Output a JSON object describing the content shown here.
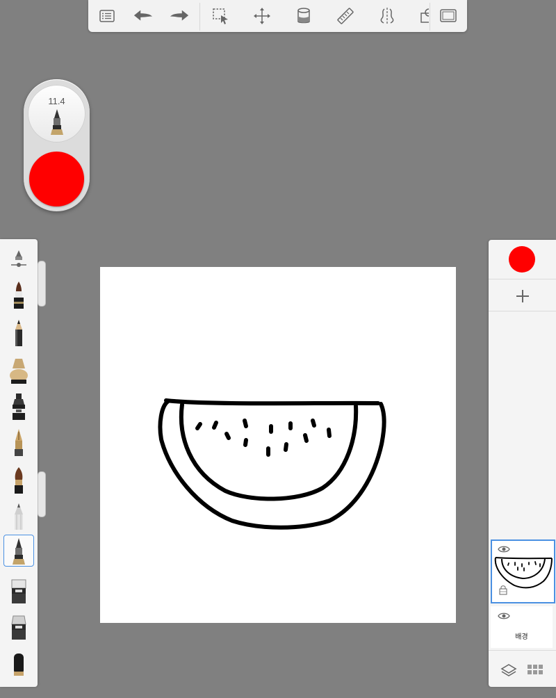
{
  "toolbar": {
    "items": [
      "list-icon",
      "undo-icon",
      "redo-icon",
      "selection-icon",
      "transform-icon",
      "fill-icon",
      "ruler-icon",
      "symmetry-icon",
      "shape-icon",
      "fullscreen-icon"
    ]
  },
  "puck": {
    "brush_size": "11.4",
    "color": "#ff0000"
  },
  "brushes": {
    "items": [
      "brush-settings",
      "felt-pen",
      "pencil",
      "airbrush",
      "marker",
      "fountain-pen",
      "paintbrush",
      "hard-pencil",
      "ballpoint-pen",
      "eraser-soft",
      "eraser-hard",
      "smudge"
    ],
    "selected": "ballpoint-pen"
  },
  "layers": {
    "color": "#ff0000",
    "items": [
      {
        "name": "",
        "visible": true,
        "selected": true
      },
      {
        "name": "배경",
        "visible": true,
        "selected": false
      }
    ]
  }
}
